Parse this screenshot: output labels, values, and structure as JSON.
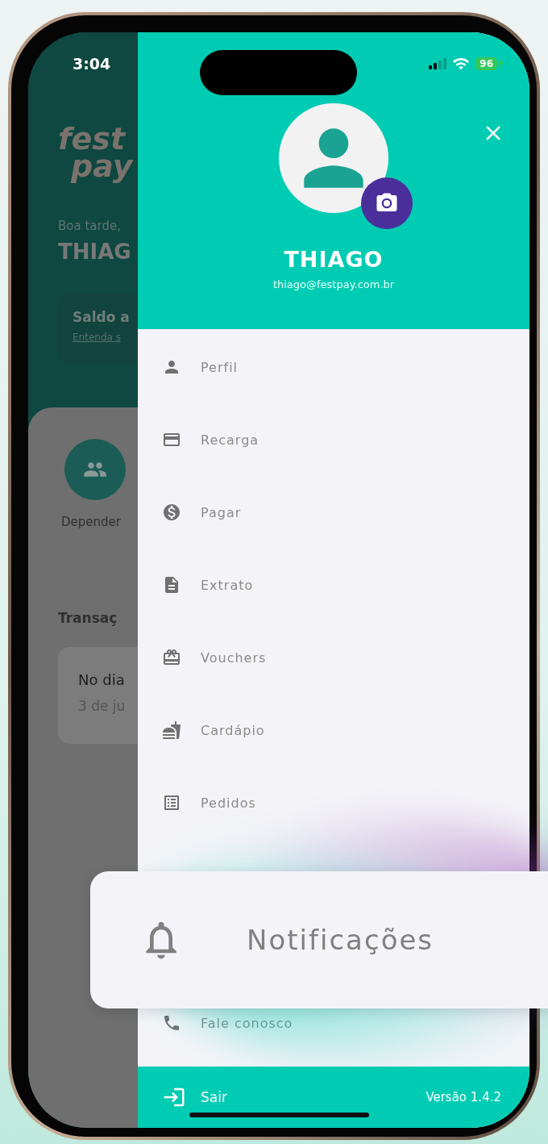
{
  "status_bar": {
    "time": "3:04",
    "battery": "96"
  },
  "background_screen": {
    "logo": [
      "fest",
      "pay"
    ],
    "greeting": "Boa tarde,",
    "name": "THIAG",
    "balance_card": {
      "title": "Saldo a",
      "link": "Entenda s"
    },
    "shortcut": {
      "label": "Depender"
    },
    "section_title": "Transaç",
    "transaction": {
      "title": "No dia",
      "date": "3 de ju"
    }
  },
  "drawer": {
    "name": "THIAGO",
    "email": "thiago@festpay.com.br",
    "menu": [
      {
        "kind": "profile",
        "label": "Perfil"
      },
      {
        "kind": "recharge",
        "label": "Recarga"
      },
      {
        "kind": "pay",
        "label": "Pagar"
      },
      {
        "kind": "statement",
        "label": "Extrato"
      },
      {
        "kind": "voucher",
        "label": "Vouchers"
      },
      {
        "kind": "menu",
        "label": "Cardápio"
      },
      {
        "kind": "orders",
        "label": "Pedidos"
      }
    ],
    "menu_bottom": [
      {
        "kind": "contact",
        "label": "Fale conosco"
      }
    ],
    "footer": {
      "logout": "Sair",
      "version": "Versão 1.4.2"
    }
  },
  "callout": {
    "label": "Notificações"
  }
}
